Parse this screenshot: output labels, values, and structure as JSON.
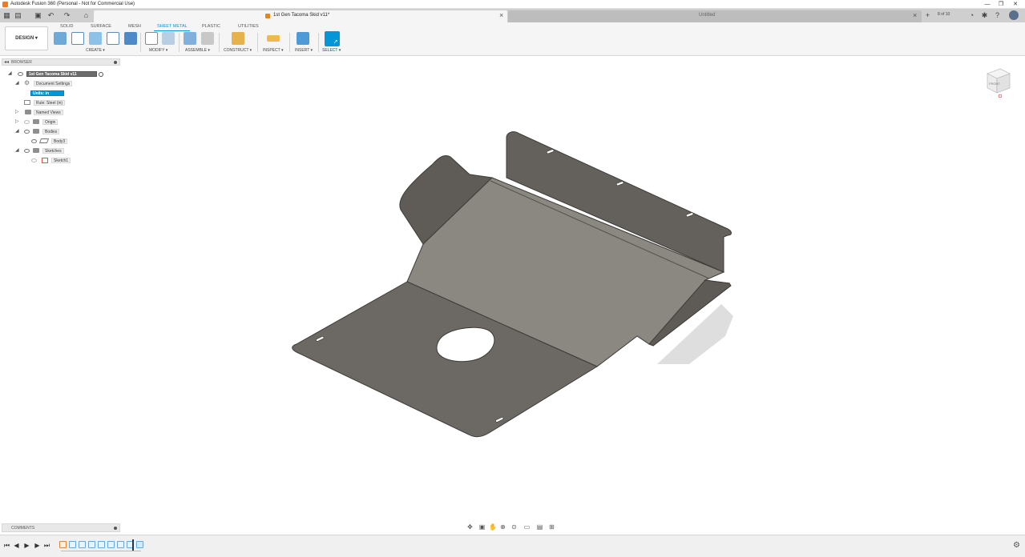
{
  "window": {
    "title": "Autodesk Fusion 360 (Personal - Not for Commercial Use)",
    "controls": [
      "—",
      "❐",
      "✕"
    ]
  },
  "tabs": {
    "active_label": "1st Gen Tacoma Skid v11*",
    "inactive_label": "Untitled",
    "job_status": "8 of 10"
  },
  "toolbar": {
    "design_label": "DESIGN ▾",
    "workspace_tabs": [
      "SOLID",
      "SURFACE",
      "MESH",
      "SHEET METAL",
      "PLASTIC",
      "UTILITIES"
    ],
    "active_workspace": "SHEET METAL",
    "groups": [
      "CREATE ▾",
      "MODIFY ▾",
      "ASSEMBLE ▾",
      "CONSTRUCT ▾",
      "INSPECT ▾",
      "INSERT ▾",
      "SELECT ▾"
    ]
  },
  "browser": {
    "title": "BROWSER",
    "root": "1st Gen Tacoma Skid v11",
    "items": [
      {
        "label": "Document Settings"
      },
      {
        "label": "Units: in"
      },
      {
        "label": "Rule: Steel (in)"
      },
      {
        "label": "Named Views"
      },
      {
        "label": "Origin"
      },
      {
        "label": "Bodies"
      },
      {
        "label": "Body3"
      },
      {
        "label": "Sketches"
      },
      {
        "label": "Sketch1"
      }
    ]
  },
  "viewcube": {
    "face": "FRONT"
  },
  "comments": {
    "label": "COMMENTS"
  },
  "colors": {
    "accent": "#0696d7",
    "part_top": "#8a8680",
    "part_front": "#6c6964",
    "part_flange": "#5f5c57",
    "shadow": "#dcdcdc"
  }
}
